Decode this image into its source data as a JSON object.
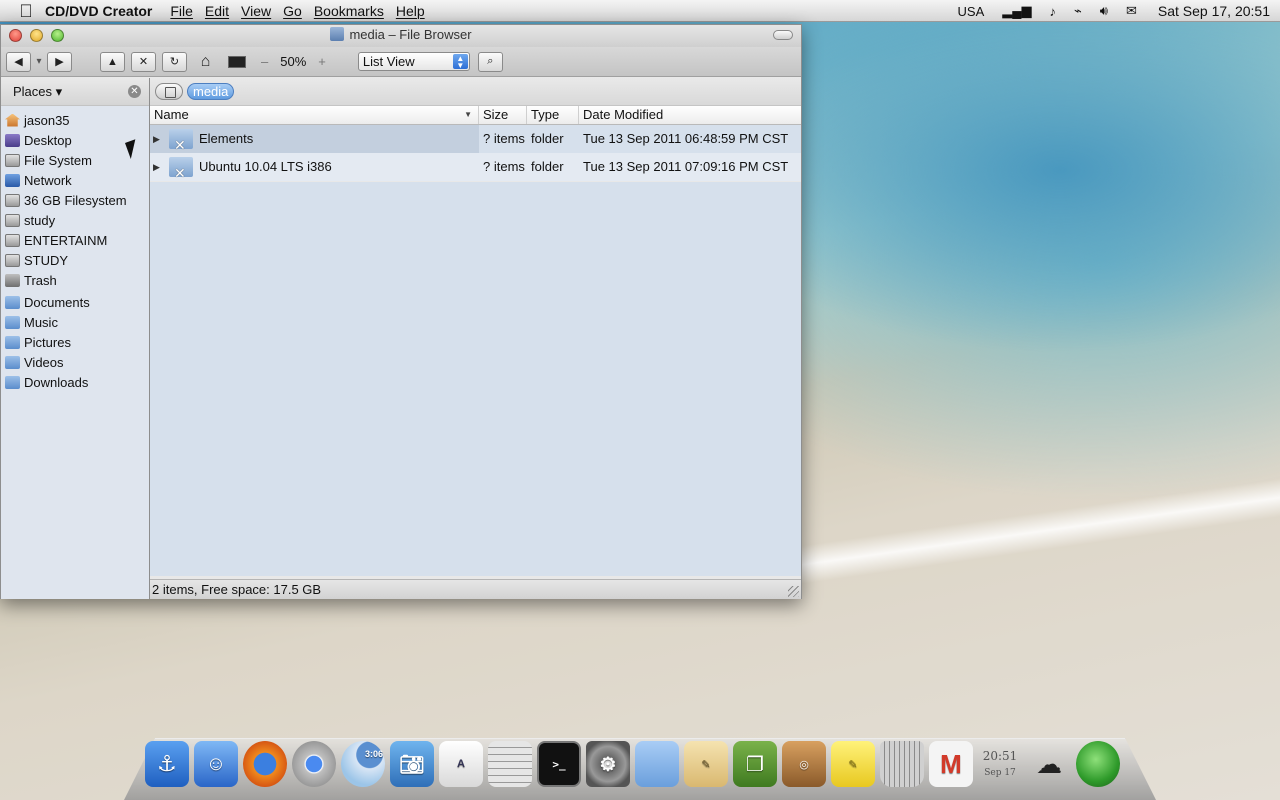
{
  "menubar": {
    "app_name": "CD/DVD Creator",
    "items": [
      {
        "label": "File"
      },
      {
        "label": "Edit"
      },
      {
        "label": "View"
      },
      {
        "label": "Go"
      },
      {
        "label": "Bookmarks"
      },
      {
        "label": "Help"
      }
    ],
    "tray": {
      "keyboard": "USA",
      "clock": "Sat Sep 17, 20:51"
    }
  },
  "window": {
    "title": "media – File Browser",
    "toolbar": {
      "zoom_minus": "–",
      "zoom_value": "50%",
      "zoom_plus": "+",
      "view_mode": "List View"
    },
    "sidebar": {
      "header": "Places",
      "items": [
        {
          "label": "jason35",
          "icon": "home-icon"
        },
        {
          "label": "Desktop",
          "icon": "desktop-icon"
        },
        {
          "label": "File System",
          "icon": "drive-icon"
        },
        {
          "label": "Network",
          "icon": "network-icon"
        },
        {
          "label": "36 GB Filesystem",
          "icon": "drive-icon"
        },
        {
          "label": "study",
          "icon": "drive-icon"
        },
        {
          "label": "ENTERTAINM",
          "icon": "drive-icon"
        },
        {
          "label": "STUDY",
          "icon": "drive-icon"
        },
        {
          "label": "Trash",
          "icon": "trash-icon"
        },
        {
          "label": "Documents",
          "icon": "folder-icon"
        },
        {
          "label": "Music",
          "icon": "folder-icon"
        },
        {
          "label": "Pictures",
          "icon": "folder-icon"
        },
        {
          "label": "Videos",
          "icon": "folder-icon"
        },
        {
          "label": "Downloads",
          "icon": "folder-icon"
        }
      ]
    },
    "pathbar": {
      "crumb": "media"
    },
    "table": {
      "columns": [
        "Name",
        "Size",
        "Type",
        "Date Modified"
      ],
      "rows": [
        {
          "name": "Elements",
          "size": "? items",
          "type": "folder",
          "date": "Tue 13 Sep 2011 06:48:59 PM CST"
        },
        {
          "name": "Ubuntu 10.04 LTS i386",
          "size": "? items",
          "type": "folder",
          "date": "Tue 13 Sep 2011 07:09:16 PM CST"
        }
      ]
    },
    "status": "2 items, Free space: 17.5 GB"
  },
  "dock": {
    "clock_time": "20:51",
    "clock_date": "Sep 17",
    "badge_time": "3:06"
  },
  "colors": {
    "selection_crumb": "#5f9be0",
    "sidebar_bg": "#dfe5ee",
    "list_bg": "#d6e0ec"
  }
}
